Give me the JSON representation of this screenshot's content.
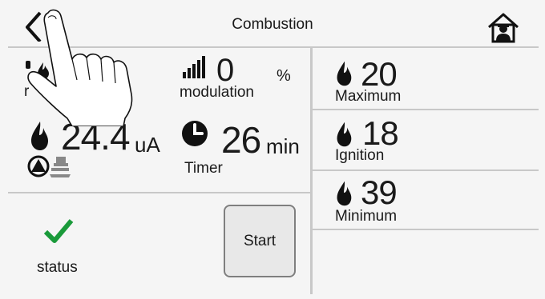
{
  "header": {
    "title": "Combustion"
  },
  "icons": {
    "back": "chevron-left-icon",
    "home": "home-person-icon",
    "flame": "flame-icon",
    "signal": "signal-bars-icon",
    "clock": "clock-icon",
    "pump": "pump-icon",
    "fan": "fan-icon",
    "check": "checkmark-icon"
  },
  "colors": {
    "accent_green": "#1a9a3a",
    "divider": "#c8c8c8",
    "button_border": "#7f7f7f",
    "background": "#f5f5f5"
  },
  "left": {
    "partial_label": "r",
    "modulation": {
      "value": "0",
      "unit": "%",
      "label": "modulation"
    },
    "current": {
      "value": "24.4",
      "unit": "uA"
    },
    "timer": {
      "value": "26",
      "unit": "min",
      "label": "Timer"
    },
    "status_label": "status",
    "start_label": "Start"
  },
  "right": {
    "maximum": {
      "value": "20",
      "label": "Maximum"
    },
    "ignition": {
      "value": "18",
      "label": "Ignition"
    },
    "minimum": {
      "value": "39",
      "label": "Minimum"
    }
  }
}
